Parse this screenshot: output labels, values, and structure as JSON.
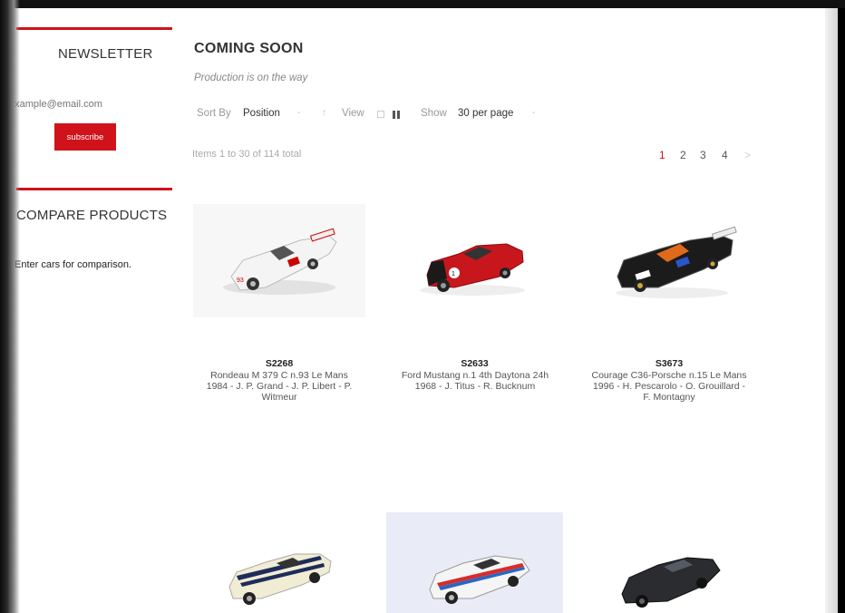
{
  "sidebar": {
    "newsletter_title": "NEWSLETTER",
    "email_placeholder": "example@email.com",
    "subscribe_label": "subscribe",
    "compare_title": "COMPARE PRODUCTS",
    "compare_text": "Enter cars for comparison."
  },
  "category": {
    "title": "COMING SOON",
    "subtitle": "Production is on the way"
  },
  "toolbar": {
    "sort_label": "Sort By",
    "sort_value": "Position",
    "view_label": "View",
    "show_label": "Show",
    "show_value": "30 per page",
    "items_total": "Items 1 to 30 of 114 total"
  },
  "pager": {
    "pages": [
      "1",
      "2",
      "3",
      "4"
    ],
    "current": "1",
    "next": ">"
  },
  "products": [
    {
      "sku": "S2268",
      "name_lines": [
        "Rondeau M 379 C n.93 Le Mans",
        "1984 - J. P. Grand - J. P. Libert - P.",
        "Witmeur"
      ],
      "image": "white-race-car"
    },
    {
      "sku": "S2633",
      "name_lines": [
        "Ford Mustang n.1 4th Daytona 24h",
        "1968 - J. Titus - R. Bucknum"
      ],
      "image": "red-mustang"
    },
    {
      "sku": "S3673",
      "name_lines": [
        "Courage C36-Porsche n.15 Le Mans",
        "1996 - H. Pescarolo - O. Grouillard -",
        "F. Montagny"
      ],
      "image": "prototype-race-car"
    },
    {
      "image": "white-mustang-striped"
    },
    {
      "image": "martini-porsche-911"
    },
    {
      "image": "grey-porsche-911"
    }
  ],
  "colors": {
    "accent": "#d0121b",
    "active_page": "#d0121b"
  }
}
